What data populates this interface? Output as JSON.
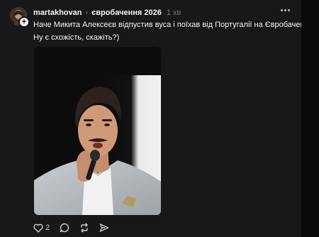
{
  "post": {
    "username": "martakhovan",
    "topic": "євробачення 2026",
    "time": "1 хв",
    "text_line1": "Наче Микита Алексеєв відпустив вуса і поїхав від Португалії на Євробачення.",
    "text_line2": "Ну є схожість, скажіть?)",
    "like_count": "2"
  },
  "icons": {
    "follow": "+",
    "chevron": "›",
    "like": "heart-icon",
    "reply": "comment-icon",
    "repost": "repost-icon",
    "share": "share-icon",
    "more": "more-icon"
  },
  "colors": {
    "background": "#181818",
    "text": "#f3f5f7",
    "muted": "#777777"
  }
}
